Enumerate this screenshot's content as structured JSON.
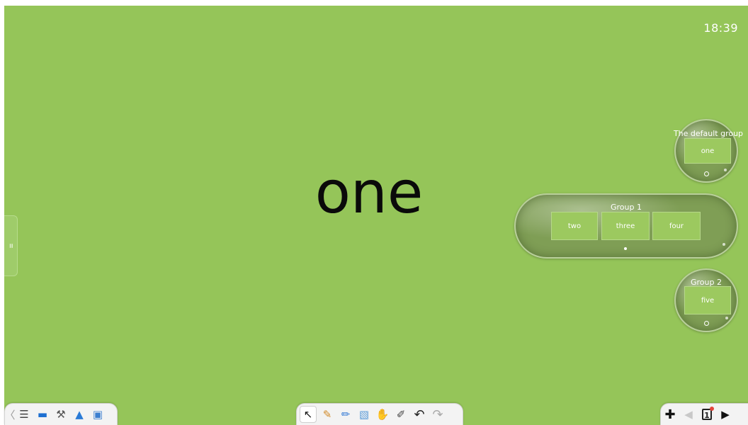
{
  "clock": "18:39",
  "slide": {
    "main_text": "one"
  },
  "side_handle": {
    "icon": "handle-grip-icon",
    "glyph": "≡"
  },
  "groups": [
    {
      "title": "The default group",
      "cards": [
        "one"
      ],
      "indicator": "open"
    },
    {
      "title": "Group 1",
      "cards": [
        "two",
        "three",
        "four"
      ],
      "indicator": "filled"
    },
    {
      "title": "Group 2",
      "cards": [
        "five"
      ],
      "indicator": "open"
    }
  ],
  "left_toolbar": {
    "items": [
      {
        "name": "collapse-left-icon",
        "glyph": "〈"
      },
      {
        "name": "menu-icon",
        "glyph": "☰"
      },
      {
        "name": "monitor-icon",
        "glyph": "▬"
      },
      {
        "name": "tools-icon",
        "glyph": "⚒"
      },
      {
        "name": "folder-upload-icon",
        "glyph": "▲"
      },
      {
        "name": "image-icon",
        "glyph": "▣"
      }
    ]
  },
  "center_toolbar": {
    "items": [
      {
        "name": "pointer-icon",
        "glyph": "↖"
      },
      {
        "name": "pen-icon",
        "glyph": "✎"
      },
      {
        "name": "highlighter-icon",
        "glyph": "✏"
      },
      {
        "name": "eraser-icon",
        "glyph": "▧"
      },
      {
        "name": "hand-icon",
        "glyph": "✋"
      },
      {
        "name": "magic-pen-icon",
        "glyph": "✐"
      },
      {
        "name": "undo-icon",
        "glyph": "↶"
      },
      {
        "name": "redo-icon",
        "glyph": "↷"
      }
    ]
  },
  "right_toolbar": {
    "page_number": "1",
    "items": [
      {
        "name": "add-page-icon",
        "glyph": "✚"
      },
      {
        "name": "previous-page-icon",
        "glyph": "◀"
      },
      {
        "name": "page-list-icon",
        "glyph": "□"
      },
      {
        "name": "next-page-icon",
        "glyph": "▶"
      }
    ]
  }
}
